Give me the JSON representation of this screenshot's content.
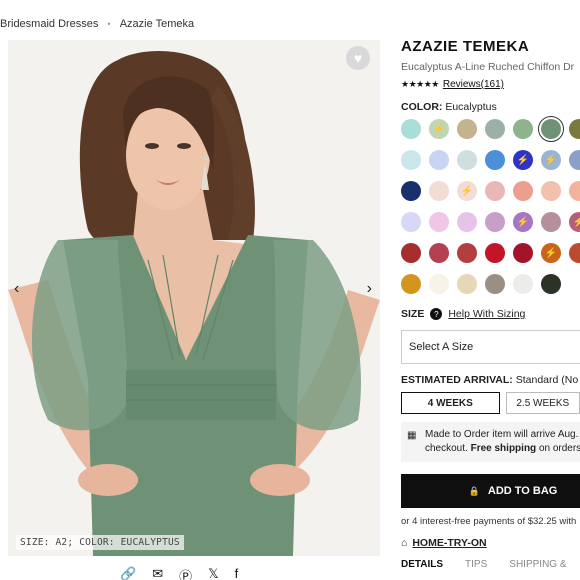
{
  "breadcrumb": {
    "items": [
      "Bridesmaid Dresses",
      "Azazie Temeka"
    ],
    "separator": "•"
  },
  "product": {
    "title": "AZAZIE TEMEKA",
    "subtitle": "Eucalyptus A-Line Ruched Chiffon Dr",
    "stars": "★★★★★",
    "rating_value": 4.5,
    "reviews": "Reviews(161)"
  },
  "photo": {
    "caption": "SIZE: A2; COLOR: EUCALYPTUS",
    "prev_arrow": "‹",
    "next_arrow": "›",
    "heart_icon": "♥",
    "dress_color": "#6f9277"
  },
  "color": {
    "label": "COLOR:",
    "value": "Eucalyptus",
    "swatches": [
      {
        "hex": "#a8ddd8"
      },
      {
        "hex": "#bfd5b3",
        "icon": "⚡"
      },
      {
        "hex": "#c4b48e"
      },
      {
        "hex": "#9bb1a6"
      },
      {
        "hex": "#8fb38a"
      },
      {
        "hex": "#6f9277",
        "selected": true
      },
      {
        "hex": "#7a7a3c"
      },
      {
        "hex": "#c9e6ec"
      },
      {
        "hex": "#c7d4f3"
      },
      {
        "hex": "#cfdfe0"
      },
      {
        "hex": "#4d8fd8"
      },
      {
        "hex": "#2b33c8",
        "icon": "⚡"
      },
      {
        "hex": "#9cb4d2",
        "icon": "⚡"
      },
      {
        "hex": "#8aa0c8"
      },
      {
        "hex": "#18306e"
      },
      {
        "hex": "#f1ddd4"
      },
      {
        "hex": "#f2dcd7",
        "icon": "⚡"
      },
      {
        "hex": "#e9b7b4"
      },
      {
        "hex": "#ec9f8f"
      },
      {
        "hex": "#f0c1ad"
      },
      {
        "hex": "#f2b39a"
      },
      {
        "hex": "#d8d8f6"
      },
      {
        "hex": "#efc6e6"
      },
      {
        "hex": "#e6c4e9"
      },
      {
        "hex": "#c79fc8"
      },
      {
        "hex": "#a774c6",
        "icon": "⚡"
      },
      {
        "hex": "#b5909c"
      },
      {
        "hex": "#b75d7a",
        "icon": "⚡"
      },
      {
        "hex": "#a52f2c"
      },
      {
        "hex": "#b44151"
      },
      {
        "hex": "#b33d3f"
      },
      {
        "hex": "#c21528"
      },
      {
        "hex": "#a3142b"
      },
      {
        "hex": "#c9651a",
        "icon": "⚡"
      },
      {
        "hex": "#bb4a31"
      },
      {
        "hex": "#d4951f"
      },
      {
        "hex": "#f7f3e8"
      },
      {
        "hex": "#e8d6b8"
      },
      {
        "hex": "#9b8f84"
      },
      {
        "hex": "#ececea"
      },
      {
        "hex": "#2d3227"
      }
    ]
  },
  "size": {
    "label": "SIZE",
    "help_icon": "?",
    "help_link": "Help With Sizing",
    "select_placeholder": "Select A Size"
  },
  "arrival": {
    "label": "ESTIMATED ARRIVAL:",
    "value": "Standard (No",
    "options": [
      "4 WEEKS",
      "2.5 WEEKS"
    ]
  },
  "notice": {
    "icon": "▦",
    "text1": "Made to Order item will arrive Aug.",
    "text2": "checkout.",
    "bold": "Free shipping",
    "text3": "on orders"
  },
  "cart": {
    "bag_icon": "🔒",
    "add_label": "ADD TO BAG",
    "payments": "or 4 interest-free payments of $32.25 with",
    "try_icon": "⌂",
    "try_label": "HOME-TRY-ON"
  },
  "tabs": [
    "DETAILS",
    "TIPS",
    "SHIPPING &"
  ],
  "share": [
    "🔗",
    "✉",
    "Ⓟ",
    "𝕏",
    "f"
  ]
}
